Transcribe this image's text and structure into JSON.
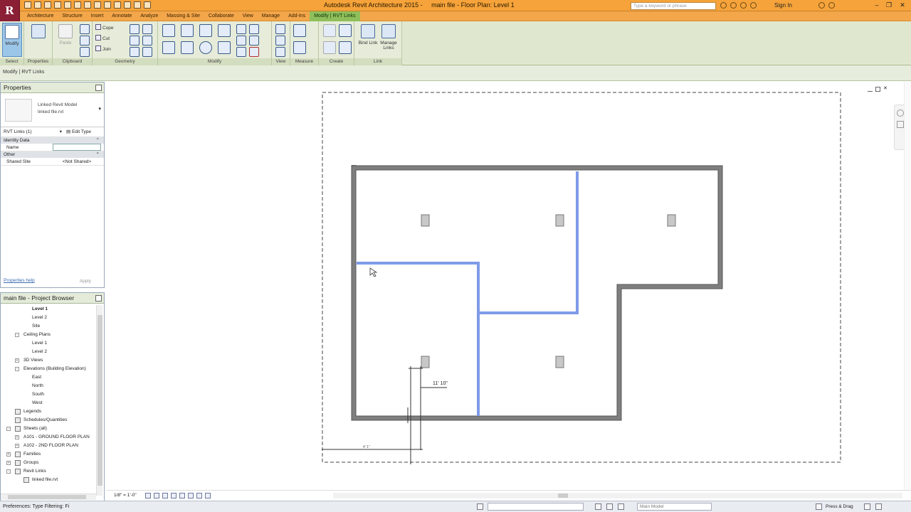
{
  "title_bar": {
    "app_title": "Autodesk Revit Architecture 2015 -",
    "document": "main file - Floor Plan: Level 1",
    "search_placeholder": "Type a keyword or phrase",
    "sign_in": "Sign In",
    "app_icon": "R"
  },
  "tabs": [
    "Architecture",
    "Structure",
    "Insert",
    "Annotate",
    "Analyze",
    "Massing & Site",
    "Collaborate",
    "View",
    "Manage",
    "Add-Ins",
    "Modify | RVT Links"
  ],
  "ribbon": {
    "panels": [
      "Select",
      "Properties",
      "Clipboard",
      "Geometry",
      "Modify",
      "View",
      "Measure",
      "Create",
      "Link"
    ],
    "modify_label": "Modify",
    "paste_label": "Paste",
    "cope_label": "Cope",
    "cut_label": "Cut",
    "join_label": "Join",
    "bind_link": "Bind Link",
    "manage_links": "Manage Links"
  },
  "context_bar": "Modify | RVT Links",
  "properties": {
    "header": "Properties",
    "type_line1": "Linked Revit Model",
    "type_line2": "linked file.rvt",
    "selector": "RVT Links (1)",
    "edit_type": "Edit Type",
    "groups": [
      {
        "name": "Identity Data",
        "rows": [
          {
            "key": "Name",
            "value": ""
          }
        ]
      },
      {
        "name": "Other",
        "rows": [
          {
            "key": "Shared Site",
            "value": "<Not Shared>"
          }
        ]
      }
    ],
    "help_link": "Properties help",
    "apply": "Apply"
  },
  "browser": {
    "header": "main file - Project Browser",
    "nodes": [
      {
        "label": "Level 1",
        "indent": 3,
        "bold": true
      },
      {
        "label": "Level 2",
        "indent": 3
      },
      {
        "label": "Site",
        "indent": 3
      },
      {
        "label": "Ceiling Plans",
        "indent": 2,
        "toggle": "-"
      },
      {
        "label": "Level 1",
        "indent": 3
      },
      {
        "label": "Level 2",
        "indent": 3
      },
      {
        "label": "3D Views",
        "indent": 2,
        "toggle": "+"
      },
      {
        "label": "Elevations (Building Elevation)",
        "indent": 2,
        "toggle": "-"
      },
      {
        "label": "East",
        "indent": 3
      },
      {
        "label": "North",
        "indent": 3
      },
      {
        "label": "South",
        "indent": 3
      },
      {
        "label": "West",
        "indent": 3
      },
      {
        "label": "Legends",
        "indent": 1,
        "icon": true
      },
      {
        "label": "Schedules/Quantities",
        "indent": 1,
        "icon": true
      },
      {
        "label": "Sheets (all)",
        "indent": 1,
        "toggle": "-",
        "icon": true
      },
      {
        "label": "A101 - GROUND FLOOR PLAN",
        "indent": 2,
        "toggle": "+"
      },
      {
        "label": "A102 - 2ND FLOOR PLAN",
        "indent": 2,
        "toggle": "+"
      },
      {
        "label": "Families",
        "indent": 1,
        "toggle": "+",
        "icon": true
      },
      {
        "label": "Groups",
        "indent": 1,
        "toggle": "+",
        "icon": true
      },
      {
        "label": "Revit Links",
        "indent": 1,
        "toggle": "-",
        "icon": true
      },
      {
        "label": "linked file.rvt",
        "indent": 2,
        "icon": true
      }
    ]
  },
  "canvas": {
    "dimension_text": "11' 10\"",
    "small_dim": "4' 1\""
  },
  "view_controls": {
    "scale": "1/8\" = 1'-0\""
  },
  "status": {
    "text": "Preferences: Type Filtering: Fi",
    "model": "Main Model",
    "press_drag": "Press & Drag"
  },
  "colors": {
    "title_bar": "#f5a33a",
    "ribbon": "#dfe8cf",
    "wall": "#7f7f7f",
    "linked_wall": "#7f9be8",
    "active_tab": "#8fbf5a"
  }
}
